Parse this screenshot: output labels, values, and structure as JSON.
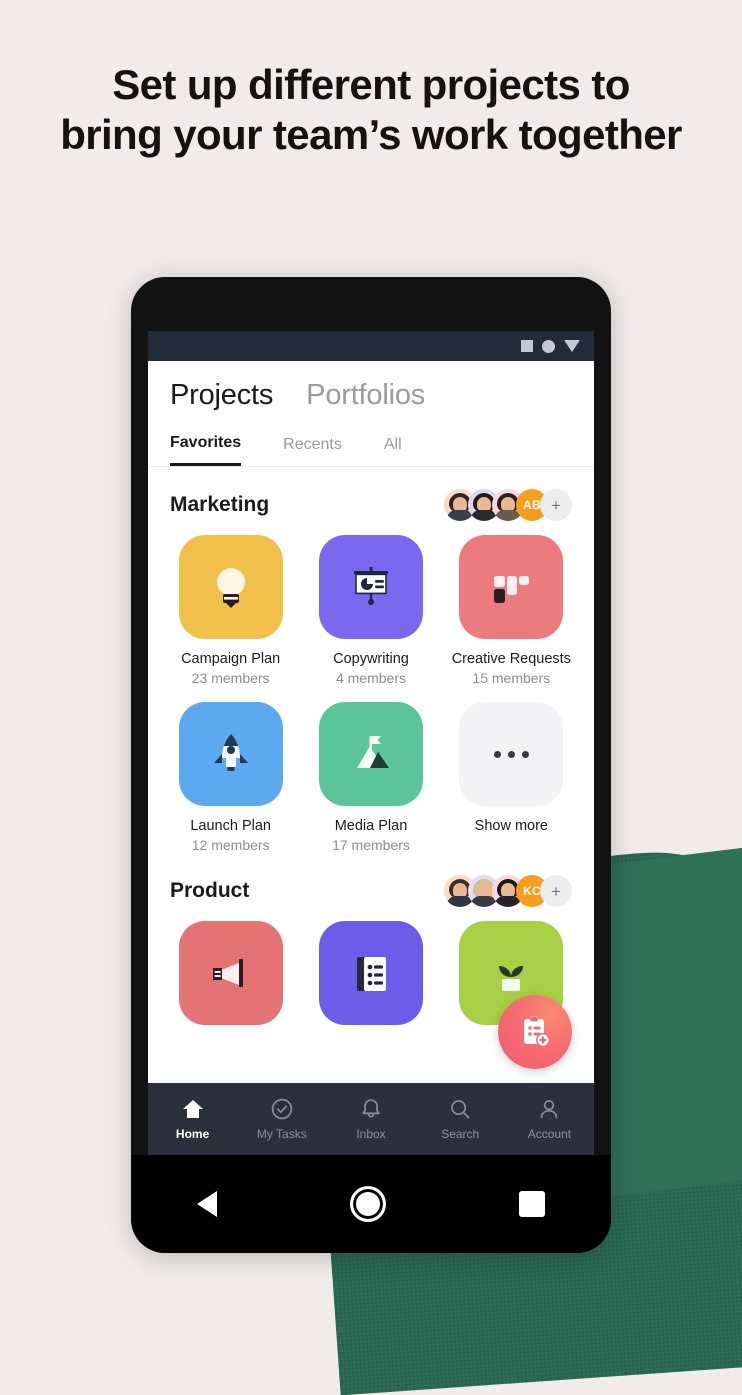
{
  "headline": {
    "line1": "Set up different projects to",
    "line2": "bring your team’s work together"
  },
  "colors": {
    "page_background": "#F1ECEB",
    "accent_green": "#2C6B55",
    "nav_background": "#2B303C",
    "status_background": "#222B3A",
    "fab": "#F76B72",
    "avatar_initials": "#F99D1C"
  },
  "phone": {
    "statusbar": {
      "icons": [
        "square-icon",
        "circle-icon",
        "triangle-down-icon"
      ]
    },
    "android_nav": {
      "back": "back-triangle-icon",
      "home": "home-circle-icon",
      "recents": "recents-square-icon"
    }
  },
  "app": {
    "primary_tabs": [
      {
        "label": "Projects",
        "active": true
      },
      {
        "label": "Portfolios",
        "active": false
      }
    ],
    "filter_tabs": [
      {
        "label": "Favorites",
        "active": true
      },
      {
        "label": "Recents",
        "active": false
      },
      {
        "label": "All",
        "active": false
      }
    ],
    "groups": [
      {
        "name": "Marketing",
        "avatars": [
          {
            "type": "photo",
            "bg": "#F7DCCB",
            "hair": "#2E2522",
            "body": "#3A3F4A"
          },
          {
            "type": "photo",
            "bg": "#DCD5F2",
            "hair": "#1E1B18",
            "body": "#2A2A2A"
          },
          {
            "type": "photo",
            "bg": "#F6D8DC",
            "hair": "#2B2017",
            "body": "#6B5A4C"
          },
          {
            "type": "initials",
            "label": "AB",
            "bg": "#F99D1C"
          },
          {
            "type": "add",
            "label": "+"
          }
        ],
        "projects": [
          {
            "title": "Campaign Plan",
            "members": "23 members",
            "icon": "lightbulb-icon",
            "color": "#F0C04A"
          },
          {
            "title": "Copywriting",
            "members": "4 members",
            "icon": "presentation-icon",
            "color": "#7B68EE"
          },
          {
            "title": "Creative Requests",
            "members": "15 members",
            "icon": "kanban-icon",
            "color": "#EC7B80"
          },
          {
            "title": "Launch Plan",
            "members": "12 members",
            "icon": "rocket-icon",
            "color": "#5CA9F0"
          },
          {
            "title": "Media Plan",
            "members": "17 members",
            "icon": "mountain-icon",
            "color": "#5CC49A"
          },
          {
            "title": "Show more",
            "members": "",
            "icon": "ellipsis-icon",
            "color": "#F3F3F5"
          }
        ]
      },
      {
        "name": "Product",
        "avatars": [
          {
            "type": "photo",
            "bg": "#F9DCC9",
            "hair": "#3B2E23",
            "body": "#2F3440"
          },
          {
            "type": "photo",
            "bg": "#E4DCF4",
            "hair": "#D9C08A",
            "body": "#3A3A44"
          },
          {
            "type": "photo",
            "bg": "#F8D7DE",
            "hair": "#1C1714",
            "body": "#24242C"
          },
          {
            "type": "initials",
            "label": "KC",
            "bg": "#F99D1C"
          },
          {
            "type": "add",
            "label": "+"
          }
        ],
        "projects": [
          {
            "title": "",
            "members": "",
            "icon": "megaphone-icon",
            "color": "#E57373"
          },
          {
            "title": "",
            "members": "",
            "icon": "notebook-icon",
            "color": "#6C5CE7"
          },
          {
            "title": "",
            "members": "",
            "icon": "plant-icon",
            "color": "#A8CF45"
          }
        ]
      }
    ],
    "fab": {
      "icon": "add-task-clipboard-icon"
    },
    "bottom_nav": [
      {
        "label": "Home",
        "icon": "home-icon",
        "active": true
      },
      {
        "label": "My Tasks",
        "icon": "check-circle-icon",
        "active": false
      },
      {
        "label": "Inbox",
        "icon": "bell-icon",
        "active": false
      },
      {
        "label": "Search",
        "icon": "search-icon",
        "active": false
      },
      {
        "label": "Account",
        "icon": "person-icon",
        "active": false
      }
    ]
  }
}
